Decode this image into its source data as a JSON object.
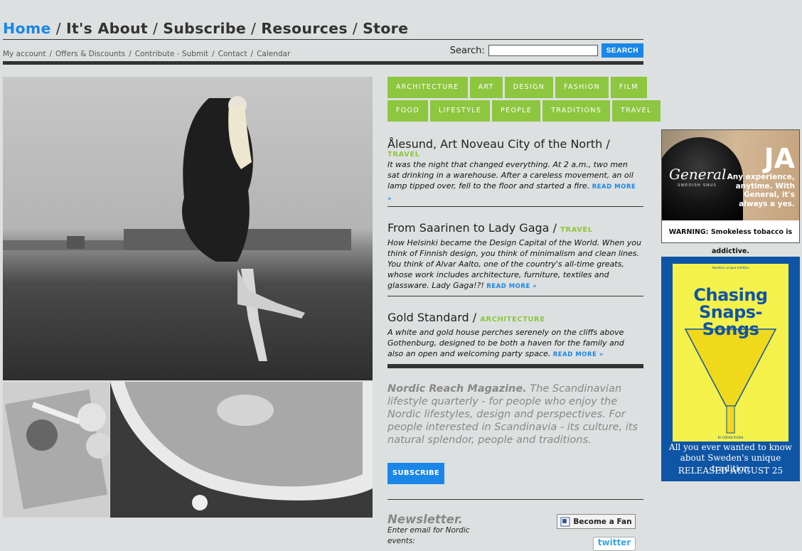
{
  "main_nav": {
    "items": [
      "Home",
      "It's About",
      "Subscribe",
      "Resources",
      "Store"
    ],
    "separator": "/",
    "active_color": "#1a86e8"
  },
  "sub_nav": {
    "items": [
      "My account",
      "Offers & Discounts",
      "Contribute - Submit",
      "Contact",
      "Calendar"
    ],
    "separator": "/"
  },
  "search": {
    "label": "Search:",
    "placeholder": "",
    "button": "SEARCH"
  },
  "categories": {
    "row1": [
      "ARCHITECTURE",
      "ART",
      "DESIGN",
      "FASHION",
      "FILM"
    ],
    "row2": [
      "FOOD",
      "LIFESTYLE",
      "PEOPLE",
      "TRADITIONS",
      "TRAVEL"
    ],
    "color": "#8dc63f"
  },
  "articles": [
    {
      "title": "Ålesund, Art Noveau City of the North",
      "separator": "/",
      "category": "TRAVEL",
      "body": "It was the night that changed everything. At 2 a.m., two men sat drinking in a warehouse. After a careless movement, an oil lamp tipped over, fell to the floor and started a fire.",
      "read_more": "READ MORE »"
    },
    {
      "title": "From Saarinen to Lady Gaga",
      "separator": "/",
      "category": "TRAVEL",
      "body": "How Helsinki became the Design Capital of the World. When you think of Finnish design, you think of minimalism and clean lines. You think of Alvar Aalto, one of the country's all-time greats, whose work includes architecture, furniture, textiles and glassware. Lady Gaga!?!",
      "read_more": "READ MORE »"
    },
    {
      "title": "Gold Standard",
      "separator": "/",
      "category": "ARCHITECTURE",
      "body": "A white and gold house perches serenely on the cliffs above Gothenburg, designed to be both a haven for the family and also an open and welcoming party space.",
      "read_more": "READ MORE »"
    }
  ],
  "about": {
    "brand": "Nordic Reach Magazine.",
    "text": "The Scandinavian lifestyle quarterly - for people who enjoy the Nordic lifestyles, design and perspectives. For people interested in Scandinavia - its culture, its natural splendor, people and traditions."
  },
  "subscribe_button": "SUBSCRIBE",
  "newsletter": {
    "title": "Newsletter.",
    "text": "Enter email for Nordic events:"
  },
  "social": {
    "fan_button": "Become a Fan",
    "twitter": "twitter"
  },
  "ads": {
    "general": {
      "brand": "General",
      "sub": "SWEDISH SNUS",
      "headline": "JA",
      "tagline": "Any experience, anytime. With General, it's always a yes.",
      "warning": "WARNING: Smokeless tobacco is addictive."
    },
    "snaps": {
      "title": "Chasing Snaps-Songs",
      "blurb": "Sweden's unique tradition",
      "author": "BY GÖRAN RYDEN",
      "line1": "All you ever wanted to know about Sweden's unique tradition",
      "line2": "RELEASED AUGUST 25"
    }
  },
  "colors": {
    "accent": "#1a86e8",
    "category_green": "#8dc63f",
    "background": "#dde0e0",
    "ad_blue": "#0f55a5",
    "ad_yellow": "#f4f14a"
  }
}
